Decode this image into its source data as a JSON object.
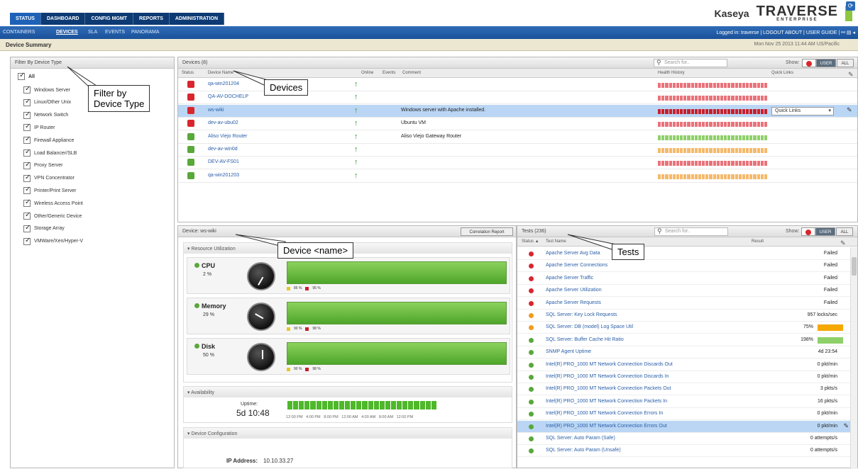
{
  "nav": {
    "tabs": [
      "STATUS",
      "DASHBOARD",
      "CONFIG MGMT",
      "REPORTS",
      "ADMINISTRATION"
    ],
    "subnav": [
      "CONTAINERS",
      "DEVICES",
      "SLA",
      "EVENTS",
      "PANORAMA"
    ],
    "right_text": "Logged in: traverse | LOGOUT    ABOUT | USER GUIDE |",
    "brand_kaseya": "Kaseya",
    "brand_traverse": "TRAVERSE",
    "brand_sub": "ENTERPRISE"
  },
  "summary": {
    "title": "Device Summary",
    "datetime": "Mon Nov 25 2013 11:44 AM US/Pacific"
  },
  "filter": {
    "title": "Filter By Device Type",
    "all_label": "All",
    "items": [
      "Windows Server",
      "Linux/Other Unix",
      "Network Switch",
      "IP Router",
      "Firewall Appliance",
      "Load Balancer/SLB",
      "Proxy Server",
      "VPN Concentrator",
      "Printer/Print Server",
      "Wireless Access Point",
      "Other/Generic Device",
      "Storage Array",
      "VMWare/Xen/Hyper-V"
    ]
  },
  "devices": {
    "title": "Devices (8)",
    "search_placeholder": "Search for..",
    "show_label": "Show:",
    "user_btn": "USER",
    "all_btn": "ALL",
    "columns": [
      "Status",
      "Device Name",
      "Online",
      "Events",
      "Comment",
      "Health History",
      "Quick Links"
    ],
    "quick_links_label": "Quick Links",
    "rows": [
      {
        "name": "qa-win201204",
        "comment": "",
        "status_color": "#d9262e",
        "health": "#e9737a"
      },
      {
        "name": "QA-AV-DOCHELP",
        "comment": "",
        "status_color": "#d9262e",
        "health": "#e9737a"
      },
      {
        "name": "ws-wiki",
        "comment": "Windows server with Apache installed.",
        "status_color": "#d9262e",
        "health": "#c8202c"
      },
      {
        "name": "dev-av-ubu02",
        "comment": "Ubuntu VM",
        "status_color": "#d9262e",
        "health": "#e9737a"
      },
      {
        "name": "Aliso Viejo Router",
        "comment": "Aliso Viejo Gateway Router",
        "status_color": "#59a83a",
        "health": "#8fd06a"
      },
      {
        "name": "dev-av-win0d",
        "comment": "",
        "status_color": "#59a83a",
        "health": "#f5b96b"
      },
      {
        "name": "DEV-AV-FS01",
        "comment": "",
        "status_color": "#59a83a",
        "health": "#e9737a"
      },
      {
        "name": "qa-win201203",
        "comment": "",
        "status_color": "#59a83a",
        "health": "#f5b96b"
      }
    ]
  },
  "device": {
    "title": "Device: ws-wiki",
    "correlation_btn": "Correlation Report",
    "resource_title": "Resource Utilization",
    "resources": [
      {
        "label": "CPU",
        "pct": "2 %",
        "legend_a": "85 %",
        "legend_b": "95 %"
      },
      {
        "label": "Memory",
        "pct": "29 %",
        "legend_a": "90 %",
        "legend_b": "98 %"
      },
      {
        "label": "Disk",
        "pct": "50 %",
        "legend_a": "90 %",
        "legend_b": "98 %"
      }
    ],
    "availability_title": "Availability",
    "uptime_label": "Uptime:",
    "uptime_value": "5d 10:48",
    "time_axis": "12:00 PM   4:00 PM   8:00 PM   12:00 AM   4:00 AM   8:00 AM   12:00 PM",
    "config_title": "Device Configuration",
    "ip_label": "IP Address:",
    "ip_value": "10.10.33.27"
  },
  "tests": {
    "title": "Tests (236)",
    "search_placeholder": "Search for..",
    "show_label": "Show:",
    "user_btn": "USER",
    "all_btn": "ALL",
    "columns": [
      "Status ▲",
      "Test Name",
      "Result"
    ],
    "rows": [
      {
        "name": "Apache Server Avg Data",
        "result": "Failed",
        "color": "#d9262e"
      },
      {
        "name": "Apache Server Connections",
        "result": "Failed",
        "color": "#d9262e"
      },
      {
        "name": "Apache Server Traffic",
        "result": "Failed",
        "color": "#d9262e"
      },
      {
        "name": "Apache Server Utilization",
        "result": "Failed",
        "color": "#d9262e"
      },
      {
        "name": "Apache Server Requests",
        "result": "Failed",
        "color": "#d9262e"
      },
      {
        "name": "SQL Server: Key Lock Requests",
        "result": "957 locks/sec",
        "color": "#f29a1f"
      },
      {
        "name": "SQL Server: DB (model) Log Space Util",
        "result": "75%",
        "color": "#f29a1f"
      },
      {
        "name": "SQL Server: Buffer Cache Hit Ratio",
        "result": "198%",
        "color": "#59a83a"
      },
      {
        "name": "SNMP Agent Uptime",
        "result": "4d 23:54",
        "color": "#59a83a"
      },
      {
        "name": "Intel(R) PRO_1000 MT Network Connection Discards Out",
        "result": "0 pkt/min",
        "color": "#59a83a"
      },
      {
        "name": "Intel(R) PRO_1000 MT Network Connection Discards In",
        "result": "0 pkt/min",
        "color": "#59a83a"
      },
      {
        "name": "Intel(R) PRO_1000 MT Network Connection Packets Out",
        "result": "3 pkts/s",
        "color": "#59a83a"
      },
      {
        "name": "Intel(R) PRO_1000 MT Network Connection Packets In",
        "result": "16 pkts/s",
        "color": "#59a83a"
      },
      {
        "name": "Intel(R) PRO_1000 MT Network Connection Errors In",
        "result": "0 pkt/min",
        "color": "#59a83a"
      },
      {
        "name": "Intel(R) PRO_1000 MT Network Connection Errors Out",
        "result": "0 pkt/min",
        "color": "#59a83a"
      },
      {
        "name": "SQL Server: Auto Param (Safe)",
        "result": "0 attempts/s",
        "color": "#59a83a"
      },
      {
        "name": "SQL Server: Auto Param (Unsafe)",
        "result": "0 attempts/s",
        "color": "#59a83a"
      }
    ]
  },
  "callouts": {
    "filter": "Filter by\nDevice Type",
    "devices": "Devices",
    "device": "Device <name>",
    "tests": "Tests"
  },
  "colors": {
    "nav_dark": "#0d3a73",
    "nav_active": "#1e62b7",
    "status_red": "#d9262e",
    "status_green": "#59a83a",
    "status_orange": "#f29a1f"
  }
}
